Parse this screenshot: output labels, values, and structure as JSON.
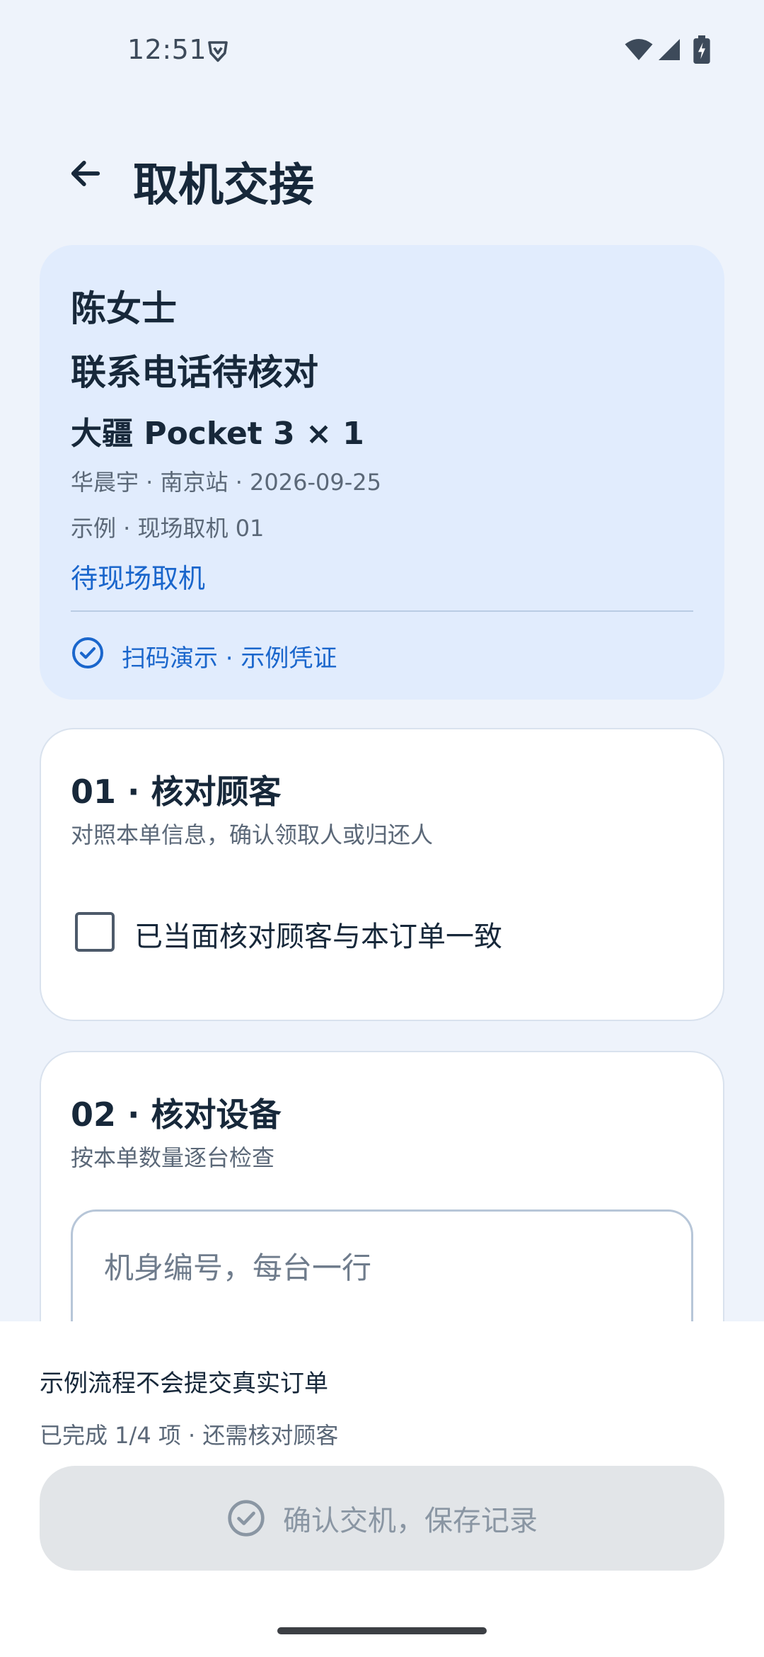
{
  "status_bar": {
    "time": "12:51",
    "icons": [
      "shield-icon",
      "wifi-icon",
      "signal-icon",
      "battery-charging-icon"
    ]
  },
  "header": {
    "title": "取机交接",
    "back_icon": "arrow-left-icon"
  },
  "order": {
    "customer_name": "陈女士",
    "phone_status": "联系电话待核对",
    "device": "大疆 Pocket 3 × 1",
    "meta_line_1": "华晨宇 · 南京站 · 2026-09-25",
    "meta_line_2": "示例 · 现场取机 01",
    "pickup_status": "待现场取机",
    "scan_label": "扫码演示 · 示例凭证",
    "accent_color": "#1a66cc",
    "card_background": "#e1ecfd"
  },
  "steps": [
    {
      "title": "01 · 核对顾客",
      "subtitle": "对照本单信息，确认领取人或归还人",
      "checkbox_label": "已当面核对顾客与本订单一致",
      "checked": false
    },
    {
      "title": "02 · 核对设备",
      "subtitle": "按本单数量逐台检查",
      "input_placeholder": "机身编号，每台一行",
      "input_value": ""
    }
  ],
  "footer": {
    "notice": "示例流程不会提交真实订单",
    "progress": "已完成 1/4 项 · 还需核对顾客",
    "confirm_label": "确认交机，保存记录",
    "confirm_icon": "check-circle-icon",
    "confirm_disabled": true
  }
}
